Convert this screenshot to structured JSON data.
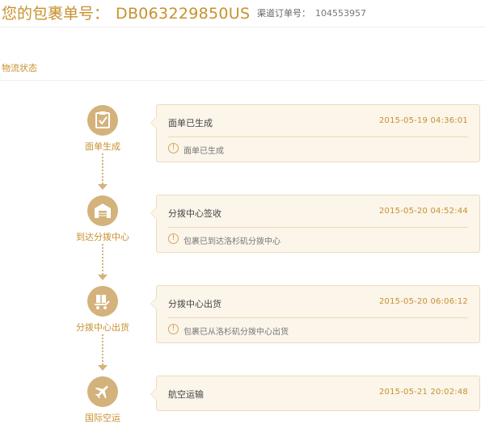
{
  "header": {
    "title_label": "您的包裹单号：",
    "tracking_number": "DB063229850US",
    "channel_label": "渠道订单号：",
    "channel_order": "104553957"
  },
  "section": {
    "title": "物流状态"
  },
  "colors": {
    "accent": "#c8912f",
    "icon_bg": "#d4b27c",
    "card_bg": "#fbf5ea"
  },
  "steps": [
    {
      "label": "面单生成",
      "icon": "document-check-icon",
      "status": "面单已生成",
      "time": "2015-05-19 04:36:01",
      "desc": "面单已生成"
    },
    {
      "label": "到达分拨中心",
      "icon": "warehouse-icon",
      "status": "分拨中心签收",
      "time": "2015-05-20 04:52:44",
      "desc": "包裹已到达洛杉矶分拨中心"
    },
    {
      "label": "分拨中心出货",
      "icon": "parcel-out-icon",
      "status": "分拨中心出货",
      "time": "2015-05-20 06:06:12",
      "desc": "包裹已从洛杉矶分拨中心出货"
    },
    {
      "label": "国际空运",
      "icon": "airplane-icon",
      "status": "航空运输",
      "time": "2015-05-21 20:02:48"
    }
  ]
}
